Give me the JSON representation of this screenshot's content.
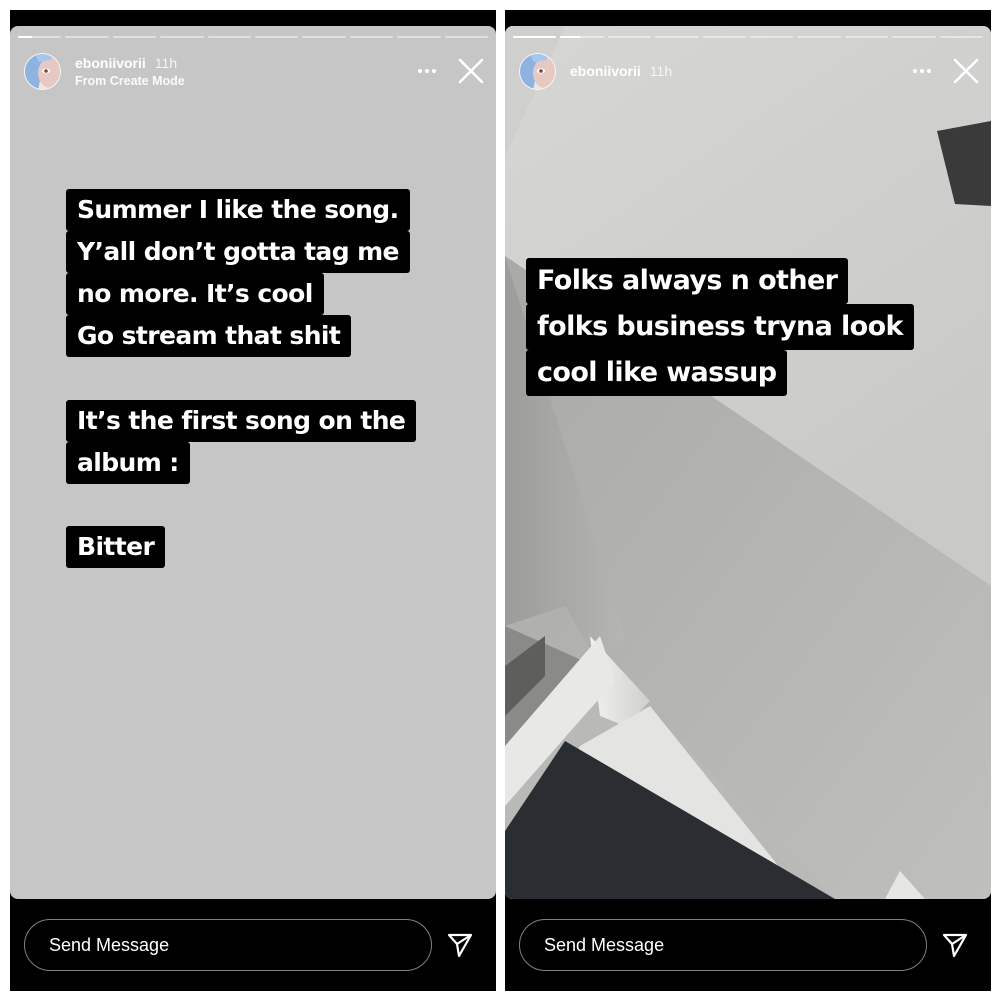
{
  "stories": [
    {
      "username": "eboniivorii",
      "time": "11h",
      "subtitle": "From Create Mode",
      "progress_fill": 0.33,
      "caption_groups": [
        [
          "Summer I like the song.",
          "Y’all don’t gotta tag me",
          "no more. It’s cool",
          "Go stream that shit"
        ],
        [
          "It’s the first song on the",
          "album :"
        ],
        [
          "Bitter"
        ]
      ],
      "message_placeholder": "Send Message",
      "background": "#c6c6c6",
      "icons": {
        "more": "more-horizontal-icon",
        "close": "close-icon",
        "send": "send-icon"
      }
    },
    {
      "username": "eboniivorii",
      "time": "11h",
      "progress_fill": 0.45,
      "caption_groups": [
        [
          "Folks always n other",
          "folks business tryna look",
          "cool like wassup"
        ]
      ],
      "message_placeholder": "Send Message",
      "background": "photo of white wall ceiling corner",
      "icons": {
        "more": "more-horizontal-icon",
        "close": "close-icon",
        "send": "send-icon"
      }
    }
  ],
  "colors": {
    "caption_bg": "#000000",
    "caption_text": "#ffffff",
    "left_story_bg": "#c6c6c6",
    "app_chrome": "#000000"
  }
}
